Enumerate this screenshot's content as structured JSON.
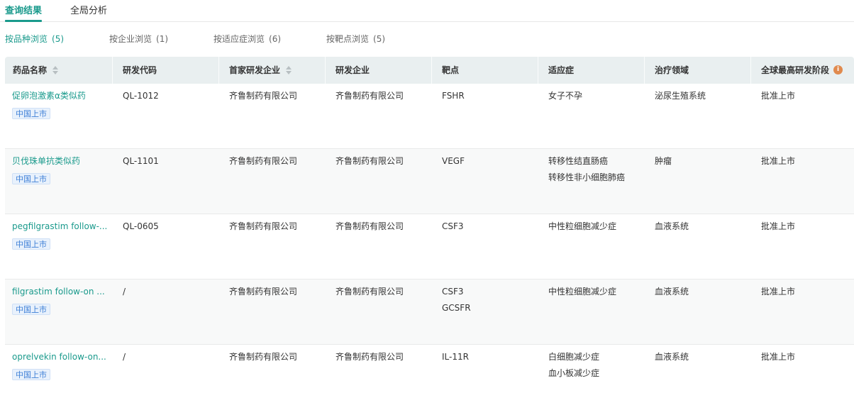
{
  "top_tabs": [
    {
      "label": "查询结果",
      "active": true
    },
    {
      "label": "全局分析",
      "active": false
    }
  ],
  "sub_tabs": [
    {
      "label": "按品种浏览",
      "count": "(5)",
      "active": true
    },
    {
      "label": "按企业浏览",
      "count": "(1)",
      "active": false
    },
    {
      "label": "按适应症浏览",
      "count": "(6)",
      "active": false
    },
    {
      "label": "按靶点浏览",
      "count": "(5)",
      "active": false
    }
  ],
  "table": {
    "columns": [
      {
        "label": "药品名称",
        "sortable": true
      },
      {
        "label": "研发代码",
        "sortable": false
      },
      {
        "label": "首家研发企业",
        "sortable": true
      },
      {
        "label": "研发企业",
        "sortable": false
      },
      {
        "label": "靶点",
        "sortable": false
      },
      {
        "label": "适应症",
        "sortable": false
      },
      {
        "label": "治疗领域",
        "sortable": false
      },
      {
        "label": "全球最高研发阶段",
        "sortable": false,
        "info_icon": "i"
      }
    ],
    "rows": [
      {
        "drug": "促卵泡激素α类似药",
        "badge": "中国上市",
        "code": "QL-1012",
        "first_company": "齐鲁制药有限公司",
        "company": "齐鲁制药有限公司",
        "targets": [
          "FSHR"
        ],
        "indications": [
          "女子不孕"
        ],
        "area": "泌尿生殖系统",
        "stage": "批准上市"
      },
      {
        "drug": "贝伐珠单抗类似药",
        "badge": "中国上市",
        "code": "QL-1101",
        "first_company": "齐鲁制药有限公司",
        "company": "齐鲁制药有限公司",
        "targets": [
          "VEGF"
        ],
        "indications": [
          "转移性结直肠癌",
          "转移性非小细胞肺癌"
        ],
        "area": "肿瘤",
        "stage": "批准上市"
      },
      {
        "drug": "pegfilgrastim follow-...",
        "badge": "中国上市",
        "code": "QL-0605",
        "first_company": "齐鲁制药有限公司",
        "company": "齐鲁制药有限公司",
        "targets": [
          "CSF3"
        ],
        "indications": [
          "中性粒细胞减少症"
        ],
        "area": "血液系统",
        "stage": "批准上市"
      },
      {
        "drug": "filgrastim follow-on ...",
        "badge": "中国上市",
        "code": "/",
        "first_company": "齐鲁制药有限公司",
        "company": "齐鲁制药有限公司",
        "targets": [
          "CSF3",
          "GCSFR"
        ],
        "indications": [
          "中性粒细胞减少症"
        ],
        "area": "血液系统",
        "stage": "批准上市"
      },
      {
        "drug": "oprelvekin follow-on...",
        "badge": "中国上市",
        "code": "/",
        "first_company": "齐鲁制药有限公司",
        "company": "齐鲁制药有限公司",
        "targets": [
          "IL-11R"
        ],
        "indications": [
          "白细胞减少症",
          "血小板减少症"
        ],
        "area": "血液系统",
        "stage": "批准上市"
      }
    ]
  },
  "colors": {
    "accent": "#1a9a8c",
    "header_bg": "#e9eff0",
    "badge_text": "#3d7fd6",
    "badge_bg": "#e8f1fc",
    "info_icon": "#e08a4e"
  }
}
